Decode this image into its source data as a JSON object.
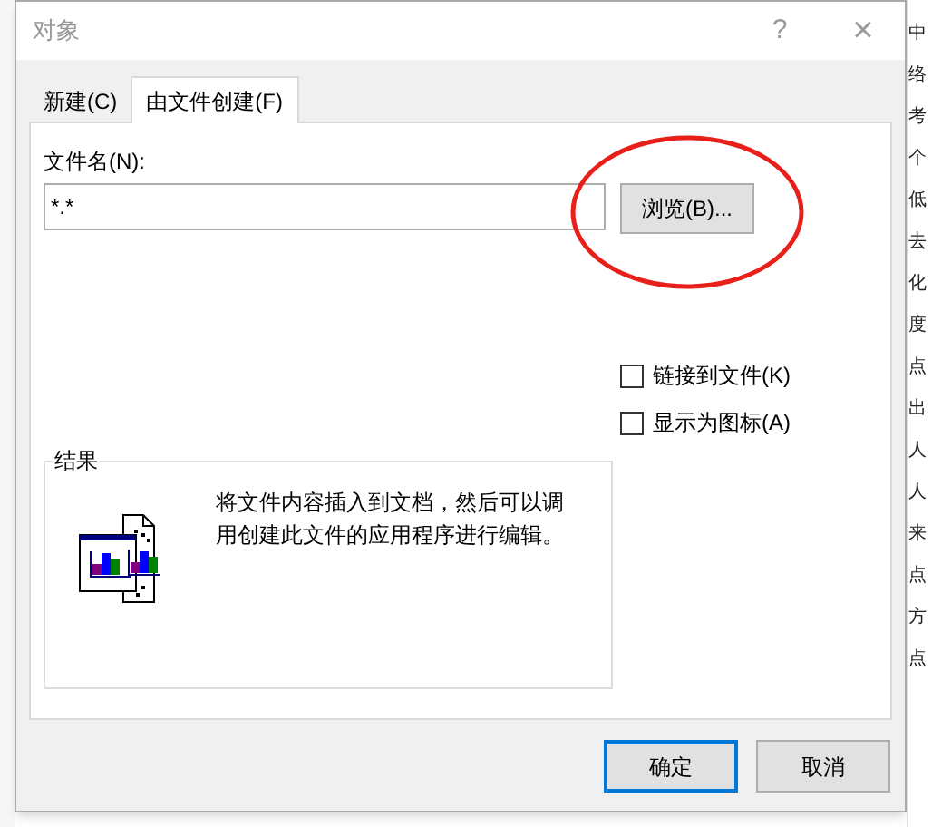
{
  "window": {
    "title": "对象",
    "buttons": [
      "?",
      "×"
    ]
  },
  "tabs": [
    {
      "label": "新建(C)",
      "selected": false
    },
    {
      "label": "由文件创建(F)",
      "selected": true
    }
  ],
  "file_name": {
    "label": "文件名(N):",
    "value": "*.*"
  },
  "browse_button": {
    "label": "浏览(B)...",
    "highlighted": true
  },
  "options": [
    {
      "label": "链接到文件(K)",
      "checked": false
    },
    {
      "label": "显示为图标(A)",
      "checked": false
    }
  ],
  "result": {
    "title": "结果",
    "text": "将文件内容插入到文档，然后可以调用创建此文件的应用程序进行编辑。"
  },
  "buttons": [
    {
      "label": "确定",
      "default": true
    },
    {
      "label": "取消",
      "default": false
    }
  ],
  "background_document": {
    "right_fragments": [
      "中",
      "络",
      "考",
      "个",
      "低",
      "去",
      "化",
      "度",
      "点",
      "出",
      "人",
      "人",
      "来",
      "点",
      "方",
      "点"
    ]
  }
}
